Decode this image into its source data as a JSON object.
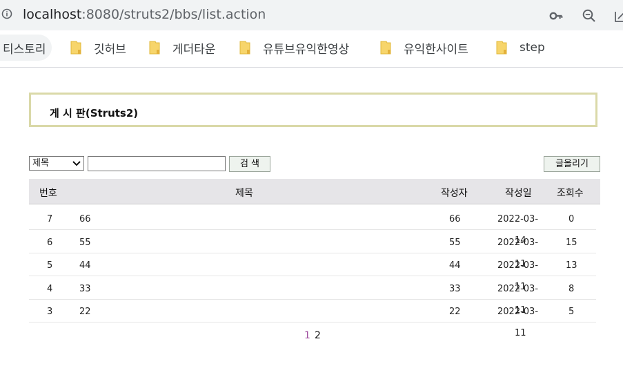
{
  "browser": {
    "url_host": "localhost",
    "url_rest": ":8080/struts2/bbs/list.action",
    "icons": [
      "info-icon",
      "key-icon",
      "zoom-out-icon",
      "share-icon"
    ]
  },
  "bookmarks": [
    {
      "label": "티스토리"
    },
    {
      "label": "깃허브"
    },
    {
      "label": "게더타운"
    },
    {
      "label": "유튜브유익한영상"
    },
    {
      "label": "유익한사이트"
    },
    {
      "label": "step"
    }
  ],
  "board": {
    "title": "게 시 판(Struts2)",
    "search_field_selected": "제목",
    "search_query": "",
    "search_button": "검 색",
    "write_button": "글올리기"
  },
  "table": {
    "headers": {
      "num": "번호",
      "subject": "제목",
      "author": "작성자",
      "date": "작성일",
      "views": "조회수"
    },
    "rows": [
      {
        "num": "7",
        "subject": "66",
        "author": "66",
        "date": "2022-03-",
        "views": "0"
      },
      {
        "num": "6",
        "subject": "55",
        "author": "55",
        "date": "2022-03-",
        "views": "15"
      },
      {
        "num": "5",
        "subject": "44",
        "author": "44",
        "date": "2022-03-",
        "views": "13"
      },
      {
        "num": "4",
        "subject": "33",
        "author": "33",
        "date": "2022-03-",
        "views": "8"
      },
      {
        "num": "3",
        "subject": "22",
        "author": "22",
        "date": "2022-03-",
        "views": "5"
      }
    ],
    "date_wrap": [
      "14",
      "11",
      "11",
      "11",
      "11"
    ]
  },
  "pagination": {
    "current": "1",
    "pages": [
      "2"
    ]
  },
  "colors": {
    "title_border": "#dad9a8",
    "header_bg": "#e6e5e8",
    "current_page": "#a050a0"
  }
}
